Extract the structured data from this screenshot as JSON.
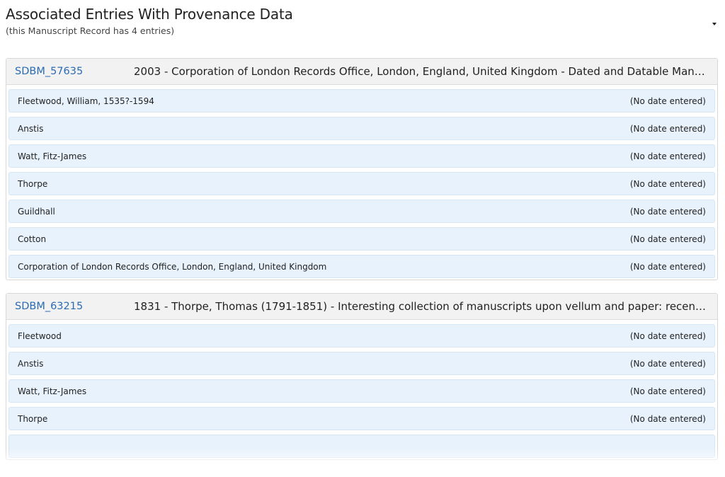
{
  "header": {
    "title": "Associated Entries With Provenance Data",
    "subtitle": "(this Manuscript Record has 4 entries)"
  },
  "groups": [
    {
      "id": "SDBM_57635",
      "summary": "2003 - Corporation of London Records Office, London, England, United Kingdom - Dated and Datable Manuscri…",
      "entries": [
        {
          "name": "Fleetwood, William, 1535?-1594",
          "date": "(No date entered)"
        },
        {
          "name": "Anstis",
          "date": "(No date entered)"
        },
        {
          "name": "Watt, Fitz-James",
          "date": "(No date entered)"
        },
        {
          "name": "Thorpe",
          "date": "(No date entered)"
        },
        {
          "name": "Guildhall",
          "date": "(No date entered)"
        },
        {
          "name": "Cotton",
          "date": "(No date entered)"
        },
        {
          "name": "Corporation of London Records Office, London, England, United Kingdom",
          "date": "(No date entered)"
        }
      ]
    },
    {
      "id": "SDBM_63215",
      "summary": "1831 - Thorpe, Thomas (1791-1851) - Interesting collection of manuscripts upon vellum and paper: recently purch…",
      "entries": [
        {
          "name": "Fleetwood",
          "date": "(No date entered)"
        },
        {
          "name": "Anstis",
          "date": "(No date entered)"
        },
        {
          "name": "Watt, Fitz-James",
          "date": "(No date entered)"
        },
        {
          "name": "Thorpe",
          "date": "(No date entered)"
        }
      ]
    }
  ],
  "colors": {
    "link": "#2a6bb3",
    "entry_bg": "#e8f2fc",
    "group_header_bg": "#f2f2f2"
  },
  "icons": {
    "collapse": "caret-down-icon"
  }
}
